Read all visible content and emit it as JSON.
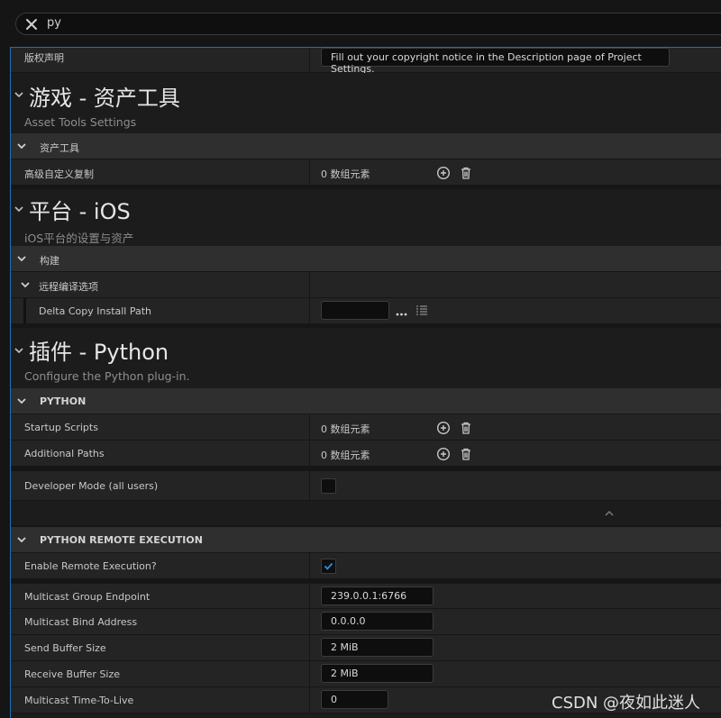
{
  "search": {
    "value": "py"
  },
  "copyright": {
    "label": "版权声明",
    "value": "Fill out your copyright notice in the Description page of Project Settings."
  },
  "asset_tools": {
    "title": "游戏 - 资产工具",
    "description": "Asset Tools Settings",
    "section": "资产工具",
    "rows": [
      {
        "label": "高级自定义复制",
        "value": "0 数组元素"
      }
    ]
  },
  "ios": {
    "title": "平台 - iOS",
    "description": "iOS平台的设置与资产",
    "section": "构建",
    "subsection": "远程编译选项",
    "delta_copy_label": "Delta Copy Install Path",
    "delta_copy_value": ""
  },
  "python": {
    "title": "插件 - Python",
    "description": "Configure the Python plug-in.",
    "section": "PYTHON",
    "startup_scripts": {
      "label": "Startup Scripts",
      "value": "0 数组元素"
    },
    "additional_paths": {
      "label": "Additional Paths",
      "value": "0 数组元素"
    },
    "developer_mode": {
      "label": "Developer Mode (all users)",
      "checked": false
    }
  },
  "remote": {
    "section": "PYTHON REMOTE EXECUTION",
    "enable": {
      "label": "Enable Remote Execution?",
      "checked": true
    },
    "multicast_group": {
      "label": "Multicast Group Endpoint",
      "value": "239.0.0.1:6766"
    },
    "multicast_bind": {
      "label": "Multicast Bind Address",
      "value": "0.0.0.0"
    },
    "send_buffer": {
      "label": "Send Buffer Size",
      "value": "2 MiB"
    },
    "receive_buffer": {
      "label": "Receive Buffer Size",
      "value": "2 MiB"
    },
    "ttl": {
      "label": "Multicast Time-To-Live",
      "value": "0"
    }
  },
  "watermark": "CSDN @夜如此迷人",
  "colors": {
    "accent": "#1e6fb8",
    "check": "#2f8fe0",
    "panel": "#1c1c1c",
    "row": "#242424",
    "section": "#2f2f2f"
  }
}
